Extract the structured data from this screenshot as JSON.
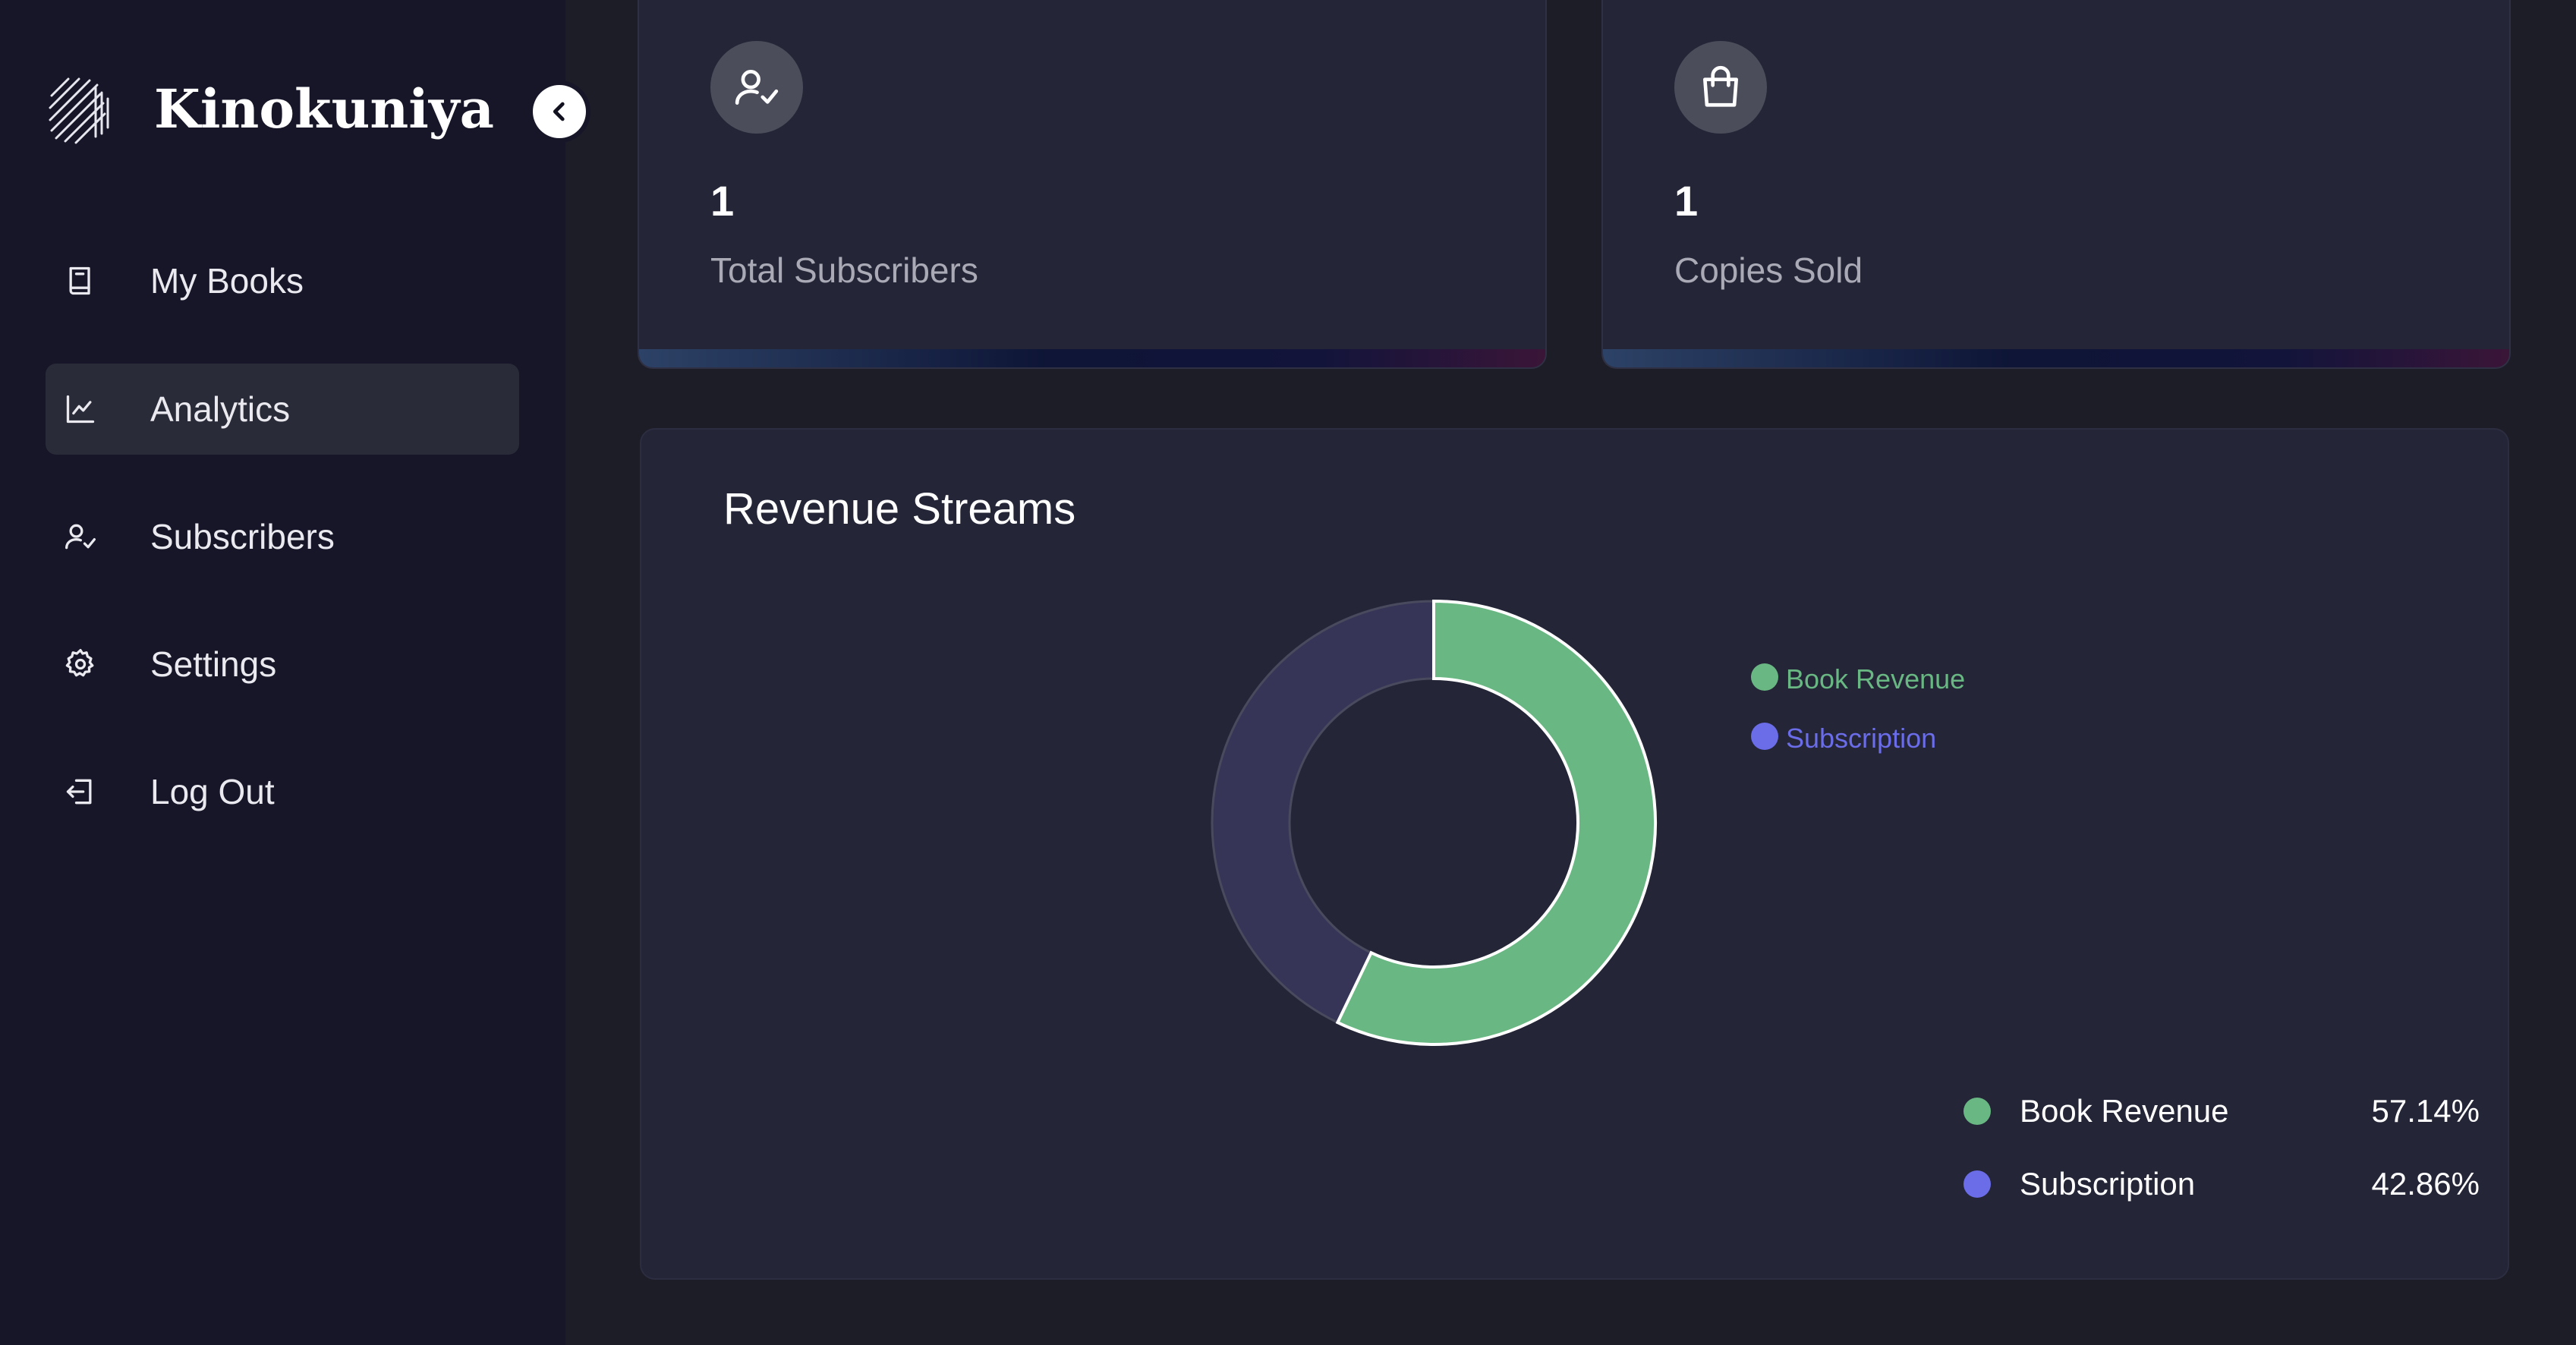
{
  "sidebar": {
    "app_name": "Kinokuniya",
    "items": [
      {
        "label": "My Books",
        "icon": "book-icon",
        "active": false
      },
      {
        "label": "Analytics",
        "icon": "chart-line-icon",
        "active": true
      },
      {
        "label": "Subscribers",
        "icon": "user-check-icon",
        "active": false
      },
      {
        "label": "Settings",
        "icon": "gear-icon",
        "active": false
      },
      {
        "label": "Log Out",
        "icon": "logout-icon",
        "active": false
      }
    ]
  },
  "stats": [
    {
      "value": "1",
      "label": "Total Subscribers",
      "icon": "user-check-icon"
    },
    {
      "value": "1",
      "label": "Copies Sold",
      "icon": "shopping-bag-icon"
    }
  ],
  "revenue": {
    "title": "Revenue Streams",
    "breakdown": [
      {
        "name": "Book Revenue",
        "percent": "57.14%"
      },
      {
        "name": "Subscription",
        "percent": "42.86%"
      }
    ]
  },
  "chart_data": {
    "type": "pie",
    "categories": [
      "Book Revenue",
      "Subscription"
    ],
    "values": [
      57.14,
      42.86
    ],
    "colors": [
      "#69b783",
      "#6a6ce8"
    ],
    "slice_colors": [
      "#69b783",
      "#363557"
    ],
    "legend": "right",
    "donut": true
  }
}
